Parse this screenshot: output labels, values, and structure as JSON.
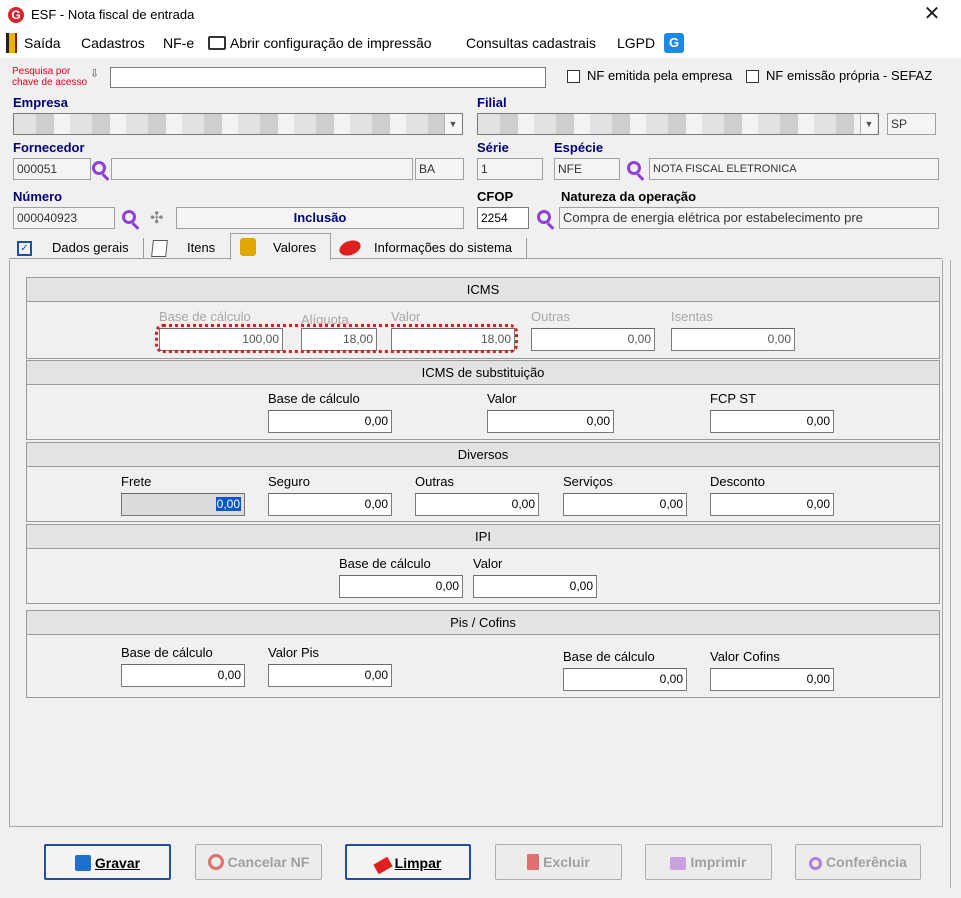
{
  "window": {
    "title": "ESF - Nota fiscal de entrada",
    "app_icon": "G"
  },
  "menu": {
    "items": [
      "Saída",
      "Cadastros",
      "NF-e",
      "Abrir configuração de impressão",
      "Consultas cadastrais",
      "LGPD"
    ]
  },
  "search": {
    "label_line1": "Pesquisa por",
    "label_line2": "chave de acesso",
    "value": "",
    "nf_emitida_label": "NF emitida pela empresa",
    "nf_propria_label": "NF emissão própria - SEFAZ"
  },
  "header": {
    "empresa_label": "Empresa",
    "filial_label": "Filial",
    "filial_uf": "SP",
    "fornecedor_label": "Fornecedor",
    "fornecedor_code": "000051",
    "fornecedor_uf": "BA",
    "serie_label": "Série",
    "serie_value": "1",
    "especie_label": "Espécie",
    "especie_value": "NFE",
    "especie_desc": "NOTA FISCAL ELETRONICA",
    "numero_label": "Número",
    "numero_value": "000040923",
    "status": "Inclusão",
    "cfop_label": "CFOP",
    "cfop_value": "2254",
    "natureza_label": "Natureza da operação",
    "natureza_value": "Compra de energia elétrica por estabelecimento pre"
  },
  "tabs": [
    "Dados gerais",
    "Itens",
    "Valores",
    "Informações do sistema"
  ],
  "icms": {
    "title": "ICMS",
    "labels": [
      "Base de cálculo",
      "Alíquota",
      "Valor",
      "Outras",
      "Isentas"
    ],
    "values": [
      "100,00",
      "18,00",
      "18,00",
      "0,00",
      "0,00"
    ]
  },
  "icms_st": {
    "title": "ICMS de substituição",
    "labels": [
      "Base de cálculo",
      "Valor",
      "FCP ST"
    ],
    "values": [
      "0,00",
      "0,00",
      "0,00"
    ]
  },
  "diversos": {
    "title": "Diversos",
    "labels": [
      "Frete",
      "Seguro",
      "Outras",
      "Serviços",
      "Desconto"
    ],
    "values": [
      "0,00",
      "0,00",
      "0,00",
      "0,00",
      "0,00"
    ]
  },
  "ipi": {
    "title": "IPI",
    "labels": [
      "Base de cálculo",
      "Valor"
    ],
    "values": [
      "0,00",
      "0,00"
    ]
  },
  "pis_cofins": {
    "title": "Pis / Cofins",
    "labels": [
      "Base de cálculo",
      "Valor Pis",
      "Base de cálculo",
      "Valor Cofins"
    ],
    "values": [
      "0,00",
      "0,00",
      "0,00",
      "0,00"
    ]
  },
  "buttons": {
    "gravar": "Gravar",
    "cancelar": "Cancelar NF",
    "limpar": "Limpar",
    "excluir": "Excluir",
    "imprimir": "Imprimir",
    "conferencia": "Conferência"
  }
}
